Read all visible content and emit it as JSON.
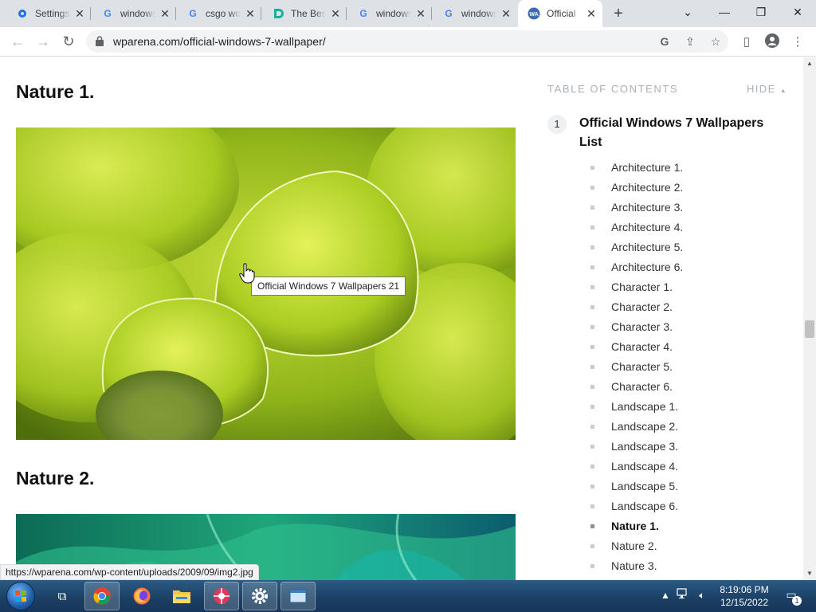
{
  "browser": {
    "tabs": [
      {
        "title": "Settings",
        "favicon": "gear-icon",
        "active": false
      },
      {
        "title": "windows",
        "favicon": "google-icon",
        "active": false
      },
      {
        "title": "csgo wo",
        "favicon": "google-icon",
        "active": false
      },
      {
        "title": "The Best",
        "favicon": "d-logo-icon",
        "active": false
      },
      {
        "title": "windows",
        "favicon": "google-icon",
        "active": false
      },
      {
        "title": "windows",
        "favicon": "google-icon",
        "active": false
      },
      {
        "title": "Official",
        "favicon": "wp-logo-icon",
        "active": true
      }
    ],
    "url": "wparena.com/official-windows-7-wallpaper/",
    "status_url": "https://wparena.com/wp-content/uploads/2009/09/img2.jpg"
  },
  "article": {
    "heading1": "Nature 1.",
    "heading2": "Nature 2.",
    "image_tooltip": "Official Windows 7 Wallpapers 21"
  },
  "toc": {
    "header": "TABLE OF CONTENTS",
    "hide_label": "HIDE",
    "main_number": "1",
    "main_title": "Official Windows 7 Wallpapers List",
    "items": [
      "Architecture 1.",
      "Architecture 2.",
      "Architecture 3.",
      "Architecture 4.",
      "Architecture 5.",
      "Architecture 6.",
      "Character 1.",
      "Character 2.",
      "Character 3.",
      "Character 4.",
      "Character 5.",
      "Character 6.",
      "Landscape 1.",
      "Landscape 2.",
      "Landscape 3.",
      "Landscape 4.",
      "Landscape 5.",
      "Landscape 6.",
      "Nature 1.",
      "Nature 2.",
      "Nature 3."
    ],
    "current_item": "Nature 1."
  },
  "taskbar": {
    "time": "8:19:06 PM",
    "date": "12/15/2022",
    "notification_count": "1"
  },
  "colors": {
    "tabstrip_bg": "#dee1e6",
    "toc_muted": "#a9b0b7",
    "taskbar_bg": "#1b3f63"
  }
}
